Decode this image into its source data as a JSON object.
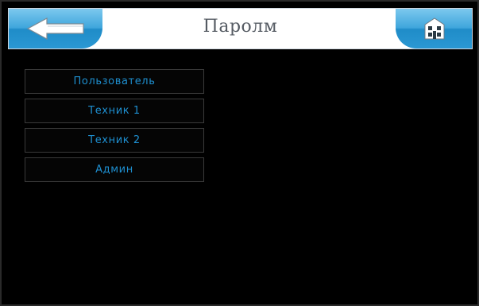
{
  "header": {
    "title": "Паролм",
    "back_icon": "back-arrow-icon",
    "home_icon": "home-icon"
  },
  "menu": {
    "items": [
      {
        "label": "Пользователь"
      },
      {
        "label": "Техник 1"
      },
      {
        "label": "Техник 2"
      },
      {
        "label": "Админ"
      }
    ]
  },
  "colors": {
    "accent": "#2b98d3",
    "menu_text": "#1e8fd0",
    "background": "#000000"
  }
}
